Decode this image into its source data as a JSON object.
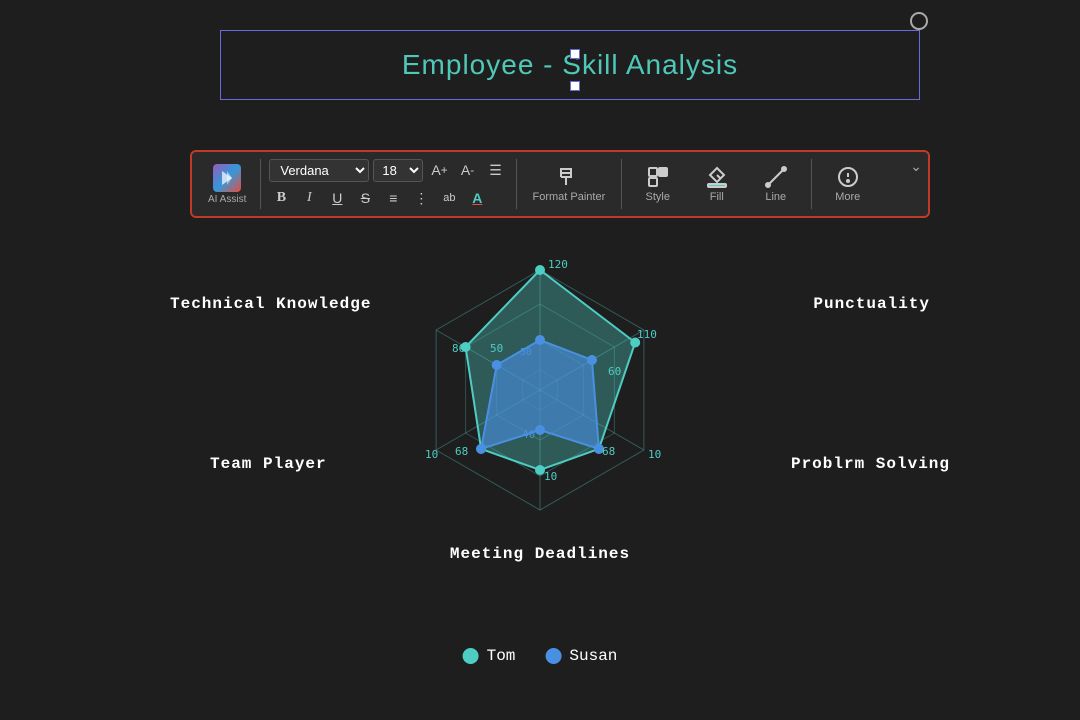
{
  "title": {
    "text": "Employee - Skill Analysis"
  },
  "toolbar": {
    "ai_assist_label": "AI Assist",
    "font_name": "Verdana",
    "font_size": "18",
    "format_painter_label": "Format Painter",
    "style_label": "Style",
    "fill_label": "Fill",
    "line_label": "Line",
    "more_label": "More"
  },
  "chart": {
    "labels": {
      "top": "120",
      "topRight": "110",
      "right_upper": "60",
      "bottomRight": "10",
      "bottom_right_val": "68",
      "bottomLeft": "10",
      "bottom_left_val": "68",
      "left_lower": "86",
      "topLeft": "50",
      "center": "40"
    },
    "axes": [
      "Technical Knowledge",
      "Punctuality",
      "Problem Solving",
      "Meeting Deadlines",
      "Team Player"
    ],
    "series": [
      {
        "name": "Tom",
        "color": "#4ecdc4",
        "dot_color": "#4ecdc4"
      },
      {
        "name": "Susan",
        "color": "#4a90e2",
        "dot_color": "#4a90e2"
      }
    ]
  },
  "legend": {
    "items": [
      {
        "name": "Tom",
        "color": "#4ecdc4"
      },
      {
        "name": "Susan",
        "color": "#4a90e2"
      }
    ]
  }
}
